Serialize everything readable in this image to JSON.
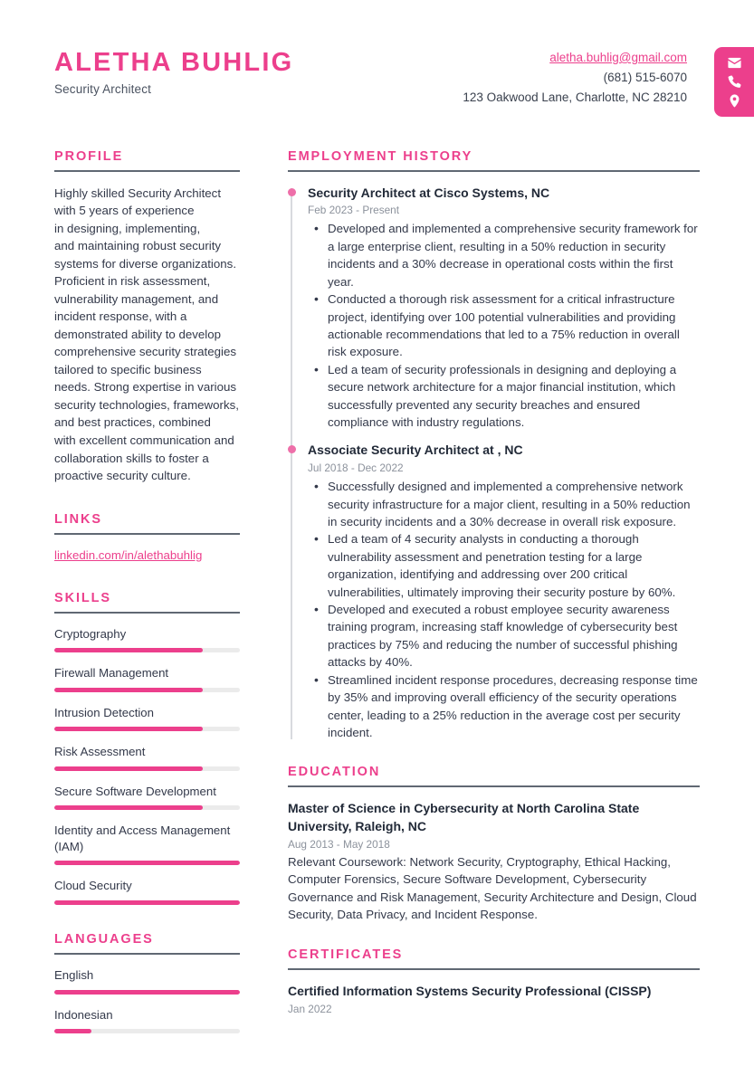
{
  "header": {
    "full_name": "ALETHA BUHLIG",
    "job_title": "Security Architect",
    "email": "aletha.buhlig@gmail.com",
    "phone": "(681) 515-6070",
    "address": "123 Oakwood Lane, Charlotte, NC 28210",
    "accent_color": "#EC3F8C",
    "icons": [
      "envelope-icon",
      "phone-icon",
      "location-pin-icon"
    ]
  },
  "profile": {
    "title": "PROFILE",
    "text": "Highly skilled Security Architect\nwith 5 years of experience\nin designing, implementing,\nand maintaining robust security\nsystems for diverse organizations.\nProficient in risk assessment,\nvulnerability management, and\nincident response, with a\ndemonstrated ability to develop\ncomprehensive security strategies\ntailored to specific business\nneeds. Strong expertise in various\nsecurity technologies, frameworks,\nand best practices, combined\nwith excellent communication and\ncollaboration skills to foster a\nproactive security culture."
  },
  "links": {
    "title": "LINKS",
    "items": [
      {
        "label": "linkedin.com/in/alethabuhlig"
      }
    ]
  },
  "skills": {
    "title": "SKILLS",
    "items": [
      {
        "label": "Cryptography",
        "level": 80
      },
      {
        "label": "Firewall Management",
        "level": 80
      },
      {
        "label": "Intrusion Detection",
        "level": 80
      },
      {
        "label": "Risk Assessment",
        "level": 80
      },
      {
        "label": "Secure Software Development",
        "level": 80
      },
      {
        "label": "Identity and Access Management (IAM)",
        "level": 100
      },
      {
        "label": "Cloud Security",
        "level": 100
      }
    ]
  },
  "languages": {
    "title": "LANGUAGES",
    "items": [
      {
        "label": "English",
        "level": 100
      },
      {
        "label": "Indonesian",
        "level": 20
      }
    ]
  },
  "employment": {
    "title": "EMPLOYMENT HISTORY",
    "jobs": [
      {
        "heading": "Security Architect at Cisco Systems, NC",
        "dates": "Feb 2023 - Present",
        "bullets": [
          "Developed and implemented a comprehensive security framework for a large enterprise client, resulting in a 50% reduction in security incidents and a 30% decrease in operational costs within the first year.",
          "Conducted a thorough risk assessment for a critical infrastructure project, identifying over 100 potential vulnerabilities and providing actionable recommendations that led to a 75% reduction in overall risk exposure.",
          "Led a team of security professionals in designing and deploying a secure network architecture for a major financial institution, which successfully prevented any security breaches and ensured compliance with industry regulations."
        ]
      },
      {
        "heading": "Associate Security Architect at , NC",
        "dates": "Jul 2018 - Dec 2022",
        "bullets": [
          "Successfully designed and implemented a comprehensive network security infrastructure for a major client, resulting in a 50% reduction in security incidents and a 30% decrease in overall risk exposure.",
          "Led a team of 4 security analysts in conducting a thorough vulnerability assessment and penetration testing for a large organization, identifying and addressing over 200 critical vulnerabilities, ultimately improving their security posture by 60%.",
          "Developed and executed a robust employee security awareness training program, increasing staff knowledge of cybersecurity best practices by 75% and reducing the number of successful phishing attacks by 40%.",
          "Streamlined incident response procedures, decreasing response time by 35% and improving overall efficiency of the security operations center, leading to a 25% reduction in the average cost per security incident."
        ]
      }
    ]
  },
  "education": {
    "title": "EDUCATION",
    "items": [
      {
        "title": "Master of Science in Cybersecurity at North Carolina State University, Raleigh, NC",
        "dates": "Aug 2013 - May 2018",
        "description": "Relevant Coursework: Network Security, Cryptography, Ethical Hacking, Computer Forensics, Secure Software Development, Cybersecurity Governance and Risk Management, Security Architecture and Design, Cloud Security, Data Privacy, and Incident Response."
      }
    ]
  },
  "certificates": {
    "title": "CERTIFICATES",
    "items": [
      {
        "title": "Certified Information Systems Security Professional (CISSP)",
        "dates": "Jan 2022"
      }
    ]
  }
}
